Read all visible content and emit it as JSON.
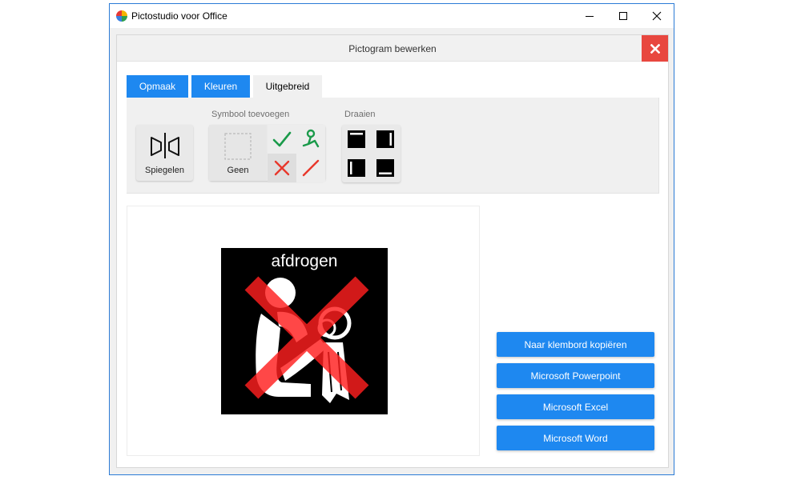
{
  "window": {
    "title": "Pictostudio voor Office"
  },
  "panel": {
    "title": "Pictogram bewerken"
  },
  "tabs": [
    {
      "label": "Opmaak"
    },
    {
      "label": "Kleuren"
    },
    {
      "label": "Uitgebreid"
    }
  ],
  "toolbar": {
    "mirror_label": "Spiegelen",
    "symbol_section": "Symbool toevoegen",
    "none_label": "Geen",
    "rotate_section": "Draaien"
  },
  "pictogram": {
    "caption": "afdrogen"
  },
  "actions": [
    {
      "label": "Naar klembord kopiëren"
    },
    {
      "label": "Microsoft Powerpoint"
    },
    {
      "label": "Microsoft Excel"
    },
    {
      "label": "Microsoft Word"
    }
  ],
  "colors": {
    "accent": "#1e88f0",
    "close_red": "#e8473f",
    "check_green": "#1a9a4a",
    "cross_red": "#e8382c"
  }
}
